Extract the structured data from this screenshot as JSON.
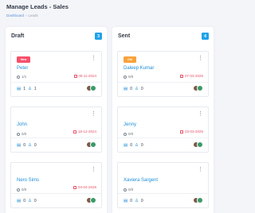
{
  "page": {
    "title": "Manage Leads - Sales",
    "breadcrumb": [
      "Dashboard",
      "Leads"
    ]
  },
  "columns": [
    {
      "title": "Draft",
      "count": "3",
      "cards": [
        {
          "badge": "New",
          "name": "Peter",
          "tasks": "1/1",
          "date": "05-11-2024",
          "files": "1",
          "members": "1"
        },
        {
          "badge": "",
          "name": "John",
          "tasks": "0/0",
          "date": "18-12-2024",
          "files": "0",
          "members": "0"
        },
        {
          "badge": "",
          "name": "Nero Sims",
          "tasks": "0/0",
          "date": "04-04-2025",
          "files": "0",
          "members": "0"
        }
      ]
    },
    {
      "title": "Sent",
      "count": "4",
      "cards": [
        {
          "badge": "Old",
          "name": "Daleep Kumar",
          "tasks": "0/0",
          "date": "07-03-2025",
          "files": "0",
          "members": "0"
        },
        {
          "badge": "",
          "name": "Jenny",
          "tasks": "0/0",
          "date": "03-03-2025",
          "files": "0",
          "members": "0"
        },
        {
          "badge": "",
          "name": "Xaviera Sargent",
          "tasks": "0/0",
          "date": "",
          "files": "0",
          "members": "0"
        }
      ]
    }
  ],
  "colors": {
    "accent": "#1fa2e8",
    "badge_new": "#f7506b",
    "badge_old": "#f9a23a",
    "date": "#e8536b"
  },
  "icons": {
    "menu": "three-dots-vertical-icon",
    "tasks": "circle-icon",
    "date": "calendar-icon",
    "files": "file-icon",
    "members": "user-icon"
  }
}
